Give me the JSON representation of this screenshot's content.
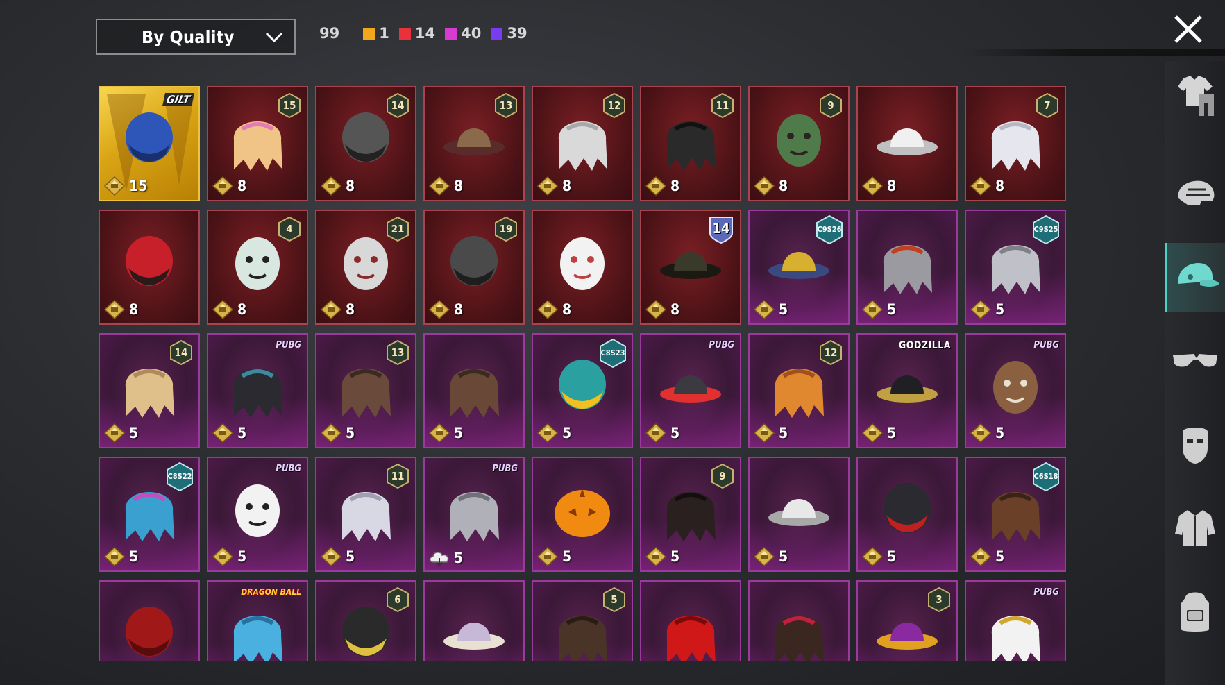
{
  "toolbar": {
    "sort_label": "By Quality",
    "total_count": "99",
    "quality_counts": [
      {
        "color": "#f3a51b",
        "count": "1"
      },
      {
        "color": "#e8313a",
        "count": "14"
      },
      {
        "color": "#d83bd2",
        "count": "40"
      },
      {
        "color": "#7a3cf0",
        "count": "39"
      }
    ]
  },
  "sidebar": {
    "categories": [
      {
        "name": "outfit",
        "icon": "outfit-icon"
      },
      {
        "name": "helmet",
        "icon": "helmet-icon"
      },
      {
        "name": "headwear",
        "icon": "cap-icon",
        "active": true
      },
      {
        "name": "eyewear",
        "icon": "glasses-icon"
      },
      {
        "name": "mask",
        "icon": "mask-icon"
      },
      {
        "name": "jacket",
        "icon": "jacket-icon"
      },
      {
        "name": "backpack",
        "icon": "backpack-icon"
      }
    ]
  },
  "items": [
    {
      "quality": "gold",
      "price": "15",
      "tag": "GILT",
      "art": "gilt-headwear"
    },
    {
      "quality": "red",
      "price": "8",
      "badge": "15",
      "art": "blonde-pink-hair"
    },
    {
      "quality": "red",
      "price": "8",
      "badge": "14",
      "art": "cat-mask-helmet"
    },
    {
      "quality": "red",
      "price": "8",
      "badge": "13",
      "art": "feather-hat-hair"
    },
    {
      "quality": "red",
      "price": "8",
      "badge": "12",
      "art": "white-bow-hair"
    },
    {
      "quality": "red",
      "price": "8",
      "badge": "11",
      "art": "black-hair"
    },
    {
      "quality": "red",
      "price": "8",
      "badge": "9",
      "art": "zombie-head"
    },
    {
      "quality": "red",
      "price": "8",
      "art": "white-cowboy-hat"
    },
    {
      "quality": "red",
      "price": "8",
      "badge": "7",
      "art": "silver-long-hair"
    },
    {
      "quality": "red",
      "price": "8",
      "art": "red-helmet"
    },
    {
      "quality": "red",
      "price": "8",
      "badge": "4",
      "art": "snowman-tophat"
    },
    {
      "quality": "red",
      "price": "8",
      "badge": "21",
      "art": "oni-mask"
    },
    {
      "quality": "red",
      "price": "8",
      "badge": "19",
      "art": "tactical-helmet"
    },
    {
      "quality": "red",
      "price": "8",
      "art": "snowman-cup"
    },
    {
      "quality": "red",
      "price": "8",
      "tag": "14",
      "art": "officer-cap"
    },
    {
      "quality": "purple",
      "price": "5",
      "season": "C9S26",
      "art": "frog-hat"
    },
    {
      "quality": "purple",
      "price": "5",
      "art": "grey-hair-goggles"
    },
    {
      "quality": "purple",
      "price": "5",
      "season": "C9S25",
      "art": "grey-bob-hair"
    },
    {
      "quality": "purple",
      "price": "5",
      "badge": "14",
      "art": "blonde-flower-hair"
    },
    {
      "quality": "purple",
      "price": "5",
      "tag": "PUBG",
      "art": "dark-ribbon-hair"
    },
    {
      "quality": "purple",
      "price": "5",
      "badge": "13",
      "art": "goggle-buns"
    },
    {
      "quality": "purple",
      "price": "5",
      "art": "headband-hair"
    },
    {
      "quality": "purple",
      "price": "5",
      "season": "C8S23",
      "art": "cat-headphones"
    },
    {
      "quality": "purple",
      "price": "5",
      "tag": "PUBG",
      "art": "visor-beanie"
    },
    {
      "quality": "purple",
      "price": "5",
      "badge": "12",
      "art": "orange-pigtails"
    },
    {
      "quality": "purple",
      "price": "5",
      "tag": "GODZILLA",
      "art": "godzilla-cap"
    },
    {
      "quality": "purple",
      "price": "5",
      "tag": "PUBG",
      "art": "bull-mask"
    },
    {
      "quality": "purple",
      "price": "5",
      "season": "C8S22",
      "art": "blue-pink-hair"
    },
    {
      "quality": "purple",
      "price": "5",
      "tag": "PUBG",
      "art": "panda-head"
    },
    {
      "quality": "purple",
      "price": "5",
      "badge": "11",
      "art": "flower-crown-hair"
    },
    {
      "quality": "purple",
      "price": "5",
      "tag": "PUBG",
      "currency": "cloud",
      "art": "silver-bob"
    },
    {
      "quality": "purple",
      "price": "5",
      "art": "pumpkin-head"
    },
    {
      "quality": "purple",
      "price": "5",
      "badge": "9",
      "art": "long-dark-hair"
    },
    {
      "quality": "purple",
      "price": "5",
      "art": "beret-white-hair"
    },
    {
      "quality": "purple",
      "price": "5",
      "art": "demon-helmet"
    },
    {
      "quality": "purple",
      "price": "5",
      "season": "C6S18",
      "art": "brown-short-hair"
    },
    {
      "quality": "purple",
      "art": "red-hood"
    },
    {
      "quality": "purple",
      "tag": "DRAGON BALL",
      "art": "blue-spiky-hair"
    },
    {
      "quality": "purple",
      "badge": "6",
      "art": "horned-helmet"
    },
    {
      "quality": "purple",
      "art": "lilac-cap-hair"
    },
    {
      "quality": "purple",
      "badge": "5",
      "art": "cat-ear-hair"
    },
    {
      "quality": "purple",
      "art": "red-long-hair"
    },
    {
      "quality": "purple",
      "art": "bow-pigtails"
    },
    {
      "quality": "purple",
      "badge": "3",
      "art": "jester-hat"
    },
    {
      "quality": "purple",
      "tag": "PUBG",
      "art": "white-veil"
    }
  ]
}
